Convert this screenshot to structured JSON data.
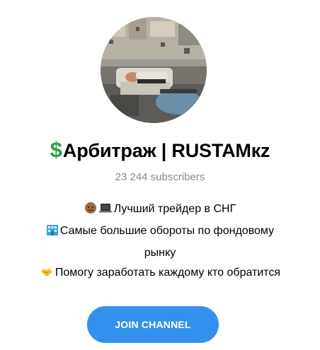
{
  "channel": {
    "title_emoji": "$",
    "title": "Арбитраж | RUSTAMкz",
    "subscribers": "23 244 subscribers",
    "description": [
      {
        "icons": [
          "face-icon",
          "laptop-icon"
        ],
        "text": "Лучший трейдер в СНГ"
      },
      {
        "icons": [
          "building-icon"
        ],
        "text": "Самые большие обороты по фондовому"
      },
      {
        "icons": [],
        "text": "рынку"
      },
      {
        "icons": [
          "handshake-icon"
        ],
        "text": "Помогу заработать каждому кто обратится"
      }
    ],
    "join_label": "JOIN CHANNEL"
  },
  "colors": {
    "accent": "#3390ec",
    "dollar": "#2ea043",
    "muted_text": "#8a8a8a"
  }
}
